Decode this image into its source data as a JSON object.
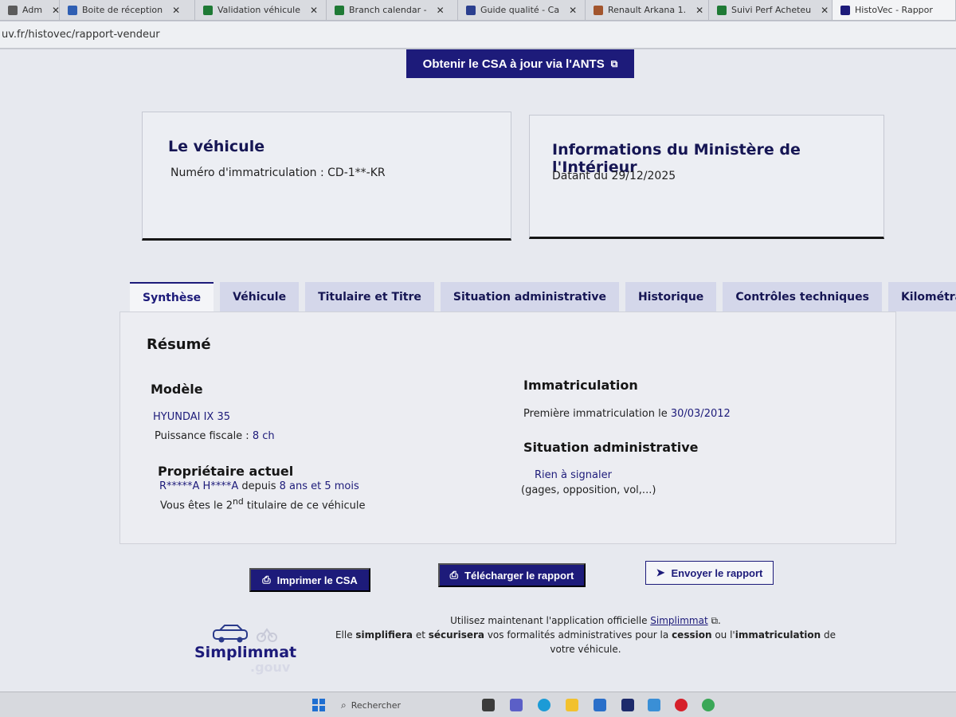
{
  "browser": {
    "tabs": [
      {
        "label": "Adm",
        "favicon_color": "#5b5b5b"
      },
      {
        "label": "Boite de réception",
        "favicon_color": "#2f5fb3"
      },
      {
        "label": "Validation véhicule",
        "favicon_color": "#1f7a35"
      },
      {
        "label": "Branch calendar -",
        "favicon_color": "#1f7a35"
      },
      {
        "label": "Guide qualité - Ca",
        "favicon_color": "#2b3f8f"
      },
      {
        "label": "Renault Arkana 1.",
        "favicon_color": "#a2552d"
      },
      {
        "label": "Suivi Perf Acheteu",
        "favicon_color": "#1f7a35"
      },
      {
        "label": "HistoVec - Rappor",
        "favicon_color": "#1d1b7a"
      }
    ],
    "url": "uv.fr/histovec/rapport-vendeur"
  },
  "ants_button": {
    "label": "Obtenir le CSA à jour via l'ANTS"
  },
  "vehicle_card": {
    "title": "Le véhicule",
    "registration_label": "Numéro d'immatriculation : ",
    "registration_value": "CD-1**-KR"
  },
  "ministry_card": {
    "title": "Informations du Ministère de l'Intérieur",
    "date_text": "Datant du 29/12/2025"
  },
  "tabs": [
    {
      "label": "Synthèse",
      "active": true
    },
    {
      "label": "Véhicule",
      "active": false
    },
    {
      "label": "Titulaire et Titre",
      "active": false
    },
    {
      "label": "Situation administrative",
      "active": false
    },
    {
      "label": "Historique",
      "active": false
    },
    {
      "label": "Contrôles techniques",
      "active": false
    },
    {
      "label": "Kilométrage",
      "active": false
    }
  ],
  "summary": {
    "title": "Résumé",
    "model": {
      "heading": "Modèle",
      "name": "HYUNDAI IX 35",
      "power_label": "Puissance fiscale : ",
      "power_value": "8 ch"
    },
    "owner": {
      "heading": "Propriétaire actuel",
      "name": "R*****A H****A",
      "since_prefix": " depuis ",
      "since_value": "8 ans et 5 mois",
      "rank_prefix": "Vous êtes le 2",
      "rank_sup": "nd",
      "rank_suffix": " titulaire de ce véhicule"
    },
    "registration": {
      "heading": "Immatriculation",
      "first_label": "Première immatriculation le ",
      "first_date": "30/03/2012"
    },
    "admin": {
      "heading": "Situation administrative",
      "status": "Rien à signaler",
      "detail": "(gages, opposition, vol,...)"
    }
  },
  "actions": {
    "print": "Imprimer le CSA",
    "download": "Télécharger le rapport",
    "send": "Envoyer le rapport"
  },
  "footer": {
    "logo_word": "Simplimmat",
    "logo_sub": ".gouv",
    "line1_prefix": "Utilisez maintenant l'application officielle ",
    "line1_link": "Simplimmat",
    "line1_suffix": ".",
    "line2_a": "Elle ",
    "line2_b": "simplifiera",
    "line2_c": " et ",
    "line2_d": "sécurisera",
    "line2_e": " vos formalités administratives pour la ",
    "line2_f": "cession",
    "line2_g": " ou l'",
    "line2_h": "immatriculation",
    "line2_i": " de",
    "line3": "votre véhicule."
  },
  "taskbar": {
    "search_placeholder": "Rechercher"
  },
  "colors": {
    "primary": "#1d1b7a",
    "panel": "#ecedf2"
  }
}
